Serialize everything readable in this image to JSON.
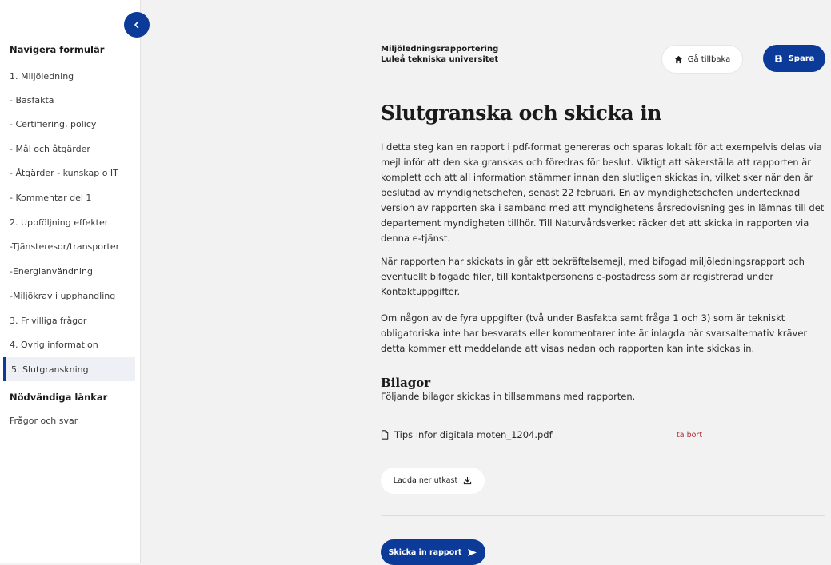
{
  "sidebar": {
    "collapse_label": "‹",
    "heading": "Navigera formulär",
    "items": [
      {
        "label": "1. Miljöledning"
      },
      {
        "label": "- Basfakta"
      },
      {
        "label": "- Certifiering, policy"
      },
      {
        "label": "- Mål och åtgärder"
      },
      {
        "label": "- Åtgärder - kunskap o IT"
      },
      {
        "label": "- Kommentar del 1"
      },
      {
        "label": "2. Uppföljning effekter"
      },
      {
        "label": "-Tjänsteresor/transporter"
      },
      {
        "label": "-Energianvändning"
      },
      {
        "label": "-Miljökrav i upphandling"
      },
      {
        "label": "3. Frivilliga frågor"
      },
      {
        "label": "4. Övrig information"
      },
      {
        "label": "5. Slutgranskning"
      }
    ],
    "links_heading": "Nödvändiga länkar",
    "links": [
      {
        "label": "Frågor och svar"
      }
    ]
  },
  "header": {
    "org_line1": "Miljöledningsrapportering",
    "org_line2": "Luleå tekniska universitet",
    "back_label": "Gå tillbaka",
    "save_label": "Spara"
  },
  "main": {
    "title": "Slutgranska och skicka in",
    "paragraphs": [
      "I detta steg kan en rapport i pdf-format genereras och sparas lokalt för att exempelvis delas via mejl inför att den ska granskas och föredras för beslut. Viktigt att säkerställa att rapporten är komplett och att all information stämmer innan den slutligen skickas in, vilket sker när den är beslutad av myndighetschefen, senast 22 februari. En av myndighetschefen undertecknad version av rapporten ska i samband med att myndighetens årsredovisning ges in lämnas till det departement myndigheten tillhör. Till Naturvårdsverket räcker det att skicka in rapporten via denna e-tjänst.",
      "När rapporten har skickats in går ett bekräftelsemejl, med bifogad miljöledningsrapport och eventuellt bifogade filer, till kontaktpersonens e-postadress som är registrerad under Kontaktuppgifter.",
      "Om någon av de fyra uppgifter (två under Basfakta samt fråga 1 och 3) som är tekniskt obligatoriska inte har besvarats eller kommentarer inte är inlagda när svarsalternativ kräver detta kommer ett meddelande att visas nedan och rapporten kan inte skickas in."
    ],
    "attachments_title": "Bilagor",
    "attachments_desc": "Följande bilagor skickas in tillsammans med rapporten.",
    "attachment_file": "Tips infor digitala moten_1204.pdf",
    "remove_label": "ta bort",
    "download_label": "Ladda ner utkast",
    "submit_label": "Skicka in rapport"
  },
  "colors": {
    "accent": "#0b3a99",
    "danger": "#b0272c",
    "background": "#f2f2f2"
  },
  "icons": {
    "collapse": "chevron-left-icon",
    "back": "home-icon",
    "save": "floppy-disk-icon",
    "file": "file-icon",
    "download": "download-icon",
    "submit": "send-icon"
  }
}
